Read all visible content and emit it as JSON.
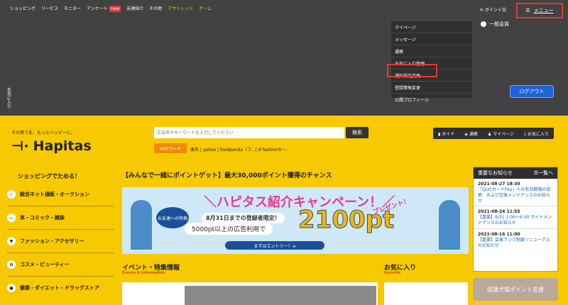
{
  "topnav": {
    "items": [
      "ショッピング",
      "リービス",
      "モニター",
      "アンケート",
      "友達紹介",
      "その他"
    ],
    "new_badge": "new",
    "highlight_items": [
      "アウトレット",
      "ゲーム"
    ],
    "point_link": "ポイント交",
    "menu_label": "メニュー"
  },
  "member": {
    "rank": "一般会員"
  },
  "logout_label": "ログアウト",
  "dropdown": {
    "items": [
      "マイページ",
      "メッセージ",
      "通帳",
      "お気に入り管理",
      "通知設定変更",
      "登録情報変更",
      "公開プロフィール"
    ]
  },
  "side_tab": "お気に入り",
  "logo": {
    "tagline": "その買うを、もっとハッピーに。",
    "name": "Hapitas"
  },
  "search": {
    "placeholder": "広告名やキーワードを入力してください",
    "button": "検索",
    "hot_label": "HOTワード",
    "hot_words": "楽天 | yahoo | foodpanda（フ.. | d fashionセー.."
  },
  "quick_links": [
    "ガイド",
    "通帳",
    "マイページ",
    "お気に入り"
  ],
  "categories": {
    "header": "ショッピングでためる！",
    "items": [
      {
        "label": "総合ネット通販・オークション",
        "icon": "cart-icon"
      },
      {
        "label": "本・コミック・雑誌",
        "icon": "book-icon"
      },
      {
        "label": "ファッション・アクセサリー",
        "icon": "shirt-icon"
      },
      {
        "label": "コスメ・ビューティー",
        "icon": "cosmetics-icon"
      },
      {
        "label": "健康・ダイエット・ドラッグストア",
        "icon": "health-icon"
      }
    ]
  },
  "campaign": {
    "title": "【みんなで一緒にポイントゲット】最大30,000ポイント獲得のチャンス",
    "banner_title": "＼ハピタス紹介キャンペーン！／",
    "banner_badge": "お友達への特典",
    "banner_date": "8月31日までの登録者限定！",
    "banner_sub": "5000pt以上の広告利用で",
    "banner_amount": "2100pt",
    "banner_present": "プレゼント！",
    "banner_cta": "まずはエントリー！ ▸"
  },
  "events": {
    "title": "イベント・特集情報",
    "subtitle": "Events & Information"
  },
  "favorites": {
    "title": "お気に入り",
    "subtitle": "Favorite"
  },
  "notice": {
    "title": "重要なお知らせ",
    "list_link": "☰一覧へ",
    "entries": [
      {
        "date": "2021-08-27 18:30",
        "text": "「QUOカードPay」への有効期限の変更、および交換メンテナンスのお知らせ"
      },
      {
        "date": "2021-08-24 11:55",
        "text": "【重要】8/31 1:00〜6:00 サイトメンテナンスのお知らせ"
      },
      {
        "date": "2021-08-16 11:00",
        "text": "【重要】会員ランク制度リニューアルのお知らせ"
      }
    ]
  },
  "protect_button": "保護犬猫ポイント支援"
}
